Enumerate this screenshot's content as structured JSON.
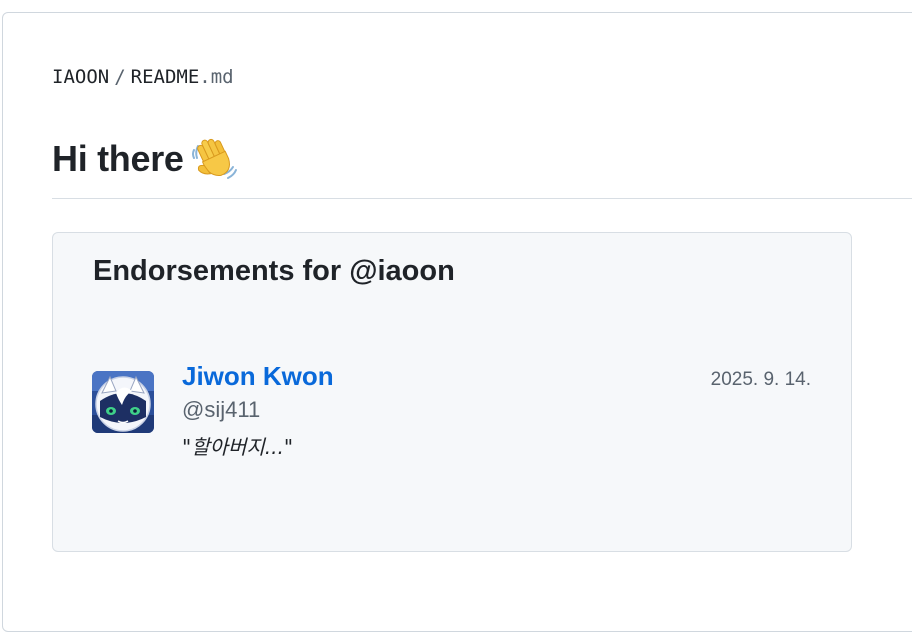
{
  "breadcrumb": {
    "owner": "IAOON",
    "separator": "/",
    "file_name": "README",
    "file_ext": ".md"
  },
  "readme": {
    "heading": "Hi there",
    "heading_icon": "waving-hand-icon"
  },
  "endorsements": {
    "title": "Endorsements for @iaoon",
    "items": [
      {
        "name": "Jiwon Kwon",
        "handle": "@sij411",
        "quote": "\"할아버지...\"",
        "date": "2025. 9. 14.",
        "avatar_icon": "avatar-cat-icon"
      }
    ]
  },
  "colors": {
    "link": "#0969da",
    "muted": "#59636e",
    "text": "#1f2328",
    "card_bg": "#f6f8fa",
    "border": "#d0d7de"
  }
}
